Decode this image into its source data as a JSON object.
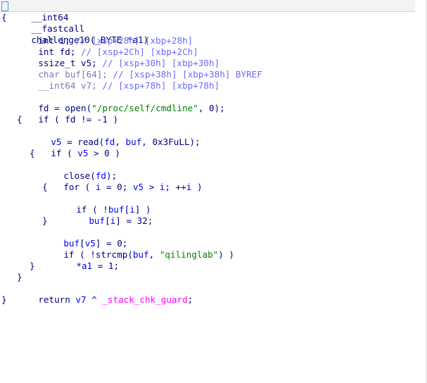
{
  "signature": {
    "type": "__int64",
    "conv": "__fastcall",
    "name": "challenge10",
    "param_type": "_BYTE",
    "param_name": "*a1"
  },
  "decls": [
    {
      "type": "int",
      "name": "i;",
      "comment": "// [xsp+28h] [xbp+28h]"
    },
    {
      "type": "int",
      "name": "fd;",
      "comment": "// [xsp+2Ch] [xbp+2Ch]"
    },
    {
      "type": "ssize_t",
      "name": "v5;",
      "comment": "// [xsp+30h] [xbp+30h]"
    },
    {
      "type": "char",
      "name": "buf[64];",
      "comment": "// [xsp+38h] [xbp+38h] BYREF"
    },
    {
      "type": "__int64",
      "name": "v7;",
      "comment": "// [xsp+78h] [xbp+78h]"
    }
  ],
  "code": {
    "open_line_pre": "fd = open(",
    "open_str": "\"/proc/self/cmdline\"",
    "open_line_post": ", 0);",
    "if1": "if ( fd != -1 )",
    "read_lhs": "v5",
    "read_eq": " = read(",
    "read_fd": "fd",
    "read_sep1": ", ",
    "read_buf": "buf",
    "read_sep2": ", 0x3FuLL);",
    "if2_pre": "if ( ",
    "if2_var": "v5",
    "if2_post": " > 0 )",
    "close_pre": "close(",
    "close_var": "fd",
    "close_post": ");",
    "for_pre": "for ( ",
    "for_i": "i",
    "for_mid": " = 0; ",
    "for_v5": "v5",
    "for_gt": " > ",
    "for_i2": "i",
    "for_inc": "; ++",
    "for_i3": "i",
    "for_end": " )",
    "if3_pre": "if ( !",
    "if3_buf": "buf",
    "if3_idx_open": "[",
    "if3_i": "i",
    "if3_post": "] )",
    "assign_buf": "buf",
    "assign_idx_open": "[",
    "assign_i": "i",
    "assign_post": "] = 32;",
    "term_buf": "buf",
    "term_idx_open": "[",
    "term_v5": "v5",
    "term_post": "] = 0;",
    "if4_pre": "if ( !strcmp(",
    "if4_buf": "buf",
    "if4_sep": ", ",
    "if4_str": "\"qilinglab\"",
    "if4_post": ") )",
    "set_pre": "*",
    "set_var": "a1",
    "set_post": " = 1;",
    "ret_pre": "return ",
    "ret_var": "v7",
    "ret_op": " ^ ",
    "ret_guard": "_stack_chk_guard",
    "ret_post": ";"
  },
  "braces": {
    "open": "{",
    "close": "}"
  }
}
